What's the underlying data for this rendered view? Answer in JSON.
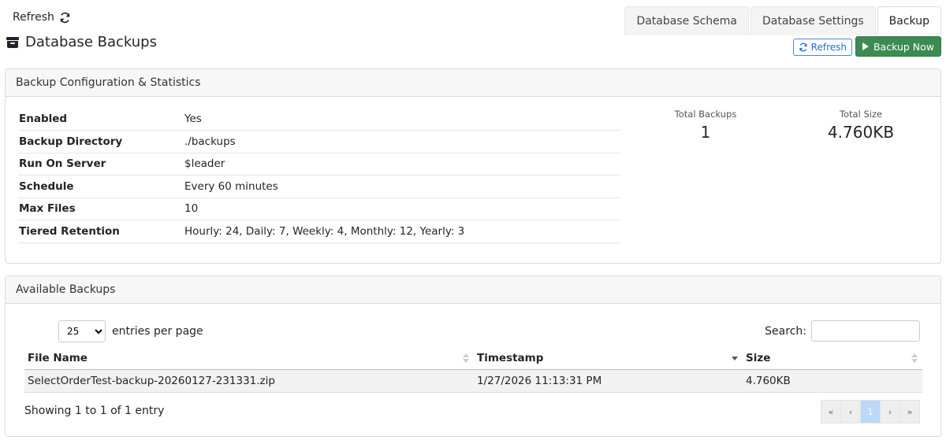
{
  "top": {
    "refresh_label": "Refresh",
    "page_title": "Database Backups"
  },
  "tabs": [
    {
      "label": "Database Schema",
      "active": false
    },
    {
      "label": "Database Settings",
      "active": false
    },
    {
      "label": "Backup",
      "active": true
    }
  ],
  "actions": {
    "refresh_label": "Refresh",
    "backup_now_label": "Backup Now"
  },
  "config": {
    "header": "Backup Configuration & Statistics",
    "rows": [
      {
        "label": "Enabled",
        "value": "Yes"
      },
      {
        "label": "Backup Directory",
        "value": "./backups"
      },
      {
        "label": "Run On Server",
        "value": "$leader"
      },
      {
        "label": "Schedule",
        "value": "Every 60 minutes"
      },
      {
        "label": "Max Files",
        "value": "10"
      },
      {
        "label": "Tiered Retention",
        "value": "Hourly: 24, Daily: 7, Weekly: 4, Monthly: 12, Yearly: 3"
      }
    ],
    "stats": {
      "total_backups_label": "Total Backups",
      "total_backups_value": "1",
      "total_size_label": "Total Size",
      "total_size_value": "4.760KB"
    }
  },
  "backups": {
    "header": "Available Backups",
    "page_size": "25",
    "entries_label": "entries per page",
    "search_label": "Search:",
    "search_value": "",
    "columns": [
      "File Name",
      "Timestamp",
      "Size"
    ],
    "rows": [
      [
        "SelectOrderTest-backup-20260127-231331.zip",
        "1/27/2026 11:13:31 PM",
        "4.760KB"
      ]
    ],
    "showing_text": "Showing 1 to 1 of 1 entry",
    "pager": {
      "first": "«",
      "prev": "‹",
      "current": "1",
      "next": "›",
      "last": "»"
    }
  },
  "colors": {
    "accent_green": "#3d8a53",
    "accent_blue": "#4d86dd"
  }
}
